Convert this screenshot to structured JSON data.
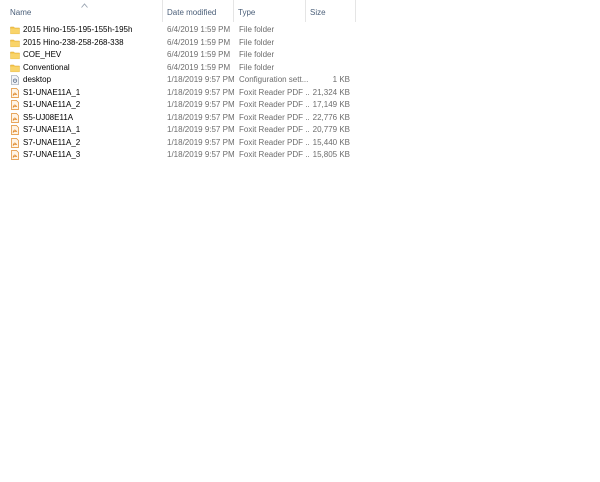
{
  "columns": {
    "name": "Name",
    "date": "Date modified",
    "type": "Type",
    "size": "Size"
  },
  "files": [
    {
      "name": "2015 Hino-155-195-155h-195h",
      "date": "6/4/2019 1:59 PM",
      "type": "File folder",
      "size": "",
      "icon": "folder-icon"
    },
    {
      "name": "2015 Hino-238-258-268-338",
      "date": "6/4/2019 1:59 PM",
      "type": "File folder",
      "size": "",
      "icon": "folder-icon"
    },
    {
      "name": "COE_HEV",
      "date": "6/4/2019 1:59 PM",
      "type": "File folder",
      "size": "",
      "icon": "folder-icon"
    },
    {
      "name": "Conventional",
      "date": "6/4/2019 1:59 PM",
      "type": "File folder",
      "size": "",
      "icon": "folder-icon"
    },
    {
      "name": "desktop",
      "date": "1/18/2019 9:57 PM",
      "type": "Configuration sett...",
      "size": "1 KB",
      "icon": "config-file-icon"
    },
    {
      "name": "S1-UNAE11A_1",
      "date": "1/18/2019 9:57 PM",
      "type": "Foxit Reader PDF ...",
      "size": "21,324 KB",
      "icon": "pdf-file-icon"
    },
    {
      "name": "S1-UNAE11A_2",
      "date": "1/18/2019 9:57 PM",
      "type": "Foxit Reader PDF ...",
      "size": "17,149 KB",
      "icon": "pdf-file-icon"
    },
    {
      "name": "S5-UJ08E11A",
      "date": "1/18/2019 9:57 PM",
      "type": "Foxit Reader PDF ...",
      "size": "22,776 KB",
      "icon": "pdf-file-icon"
    },
    {
      "name": "S7-UNAE11A_1",
      "date": "1/18/2019 9:57 PM",
      "type": "Foxit Reader PDF ...",
      "size": "20,779 KB",
      "icon": "pdf-file-icon"
    },
    {
      "name": "S7-UNAE11A_2",
      "date": "1/18/2019 9:57 PM",
      "type": "Foxit Reader PDF ...",
      "size": "15,440 KB",
      "icon": "pdf-file-icon"
    },
    {
      "name": "S7-UNAE11A_3",
      "date": "1/18/2019 9:57 PM",
      "type": "Foxit Reader PDF ...",
      "size": "15,805 KB",
      "icon": "pdf-file-icon"
    }
  ],
  "colors": {
    "folder": "#f5c54a",
    "pdf": "#e08a2c",
    "header_text": "#4c607a",
    "secondary_text": "#6d6d6d"
  }
}
